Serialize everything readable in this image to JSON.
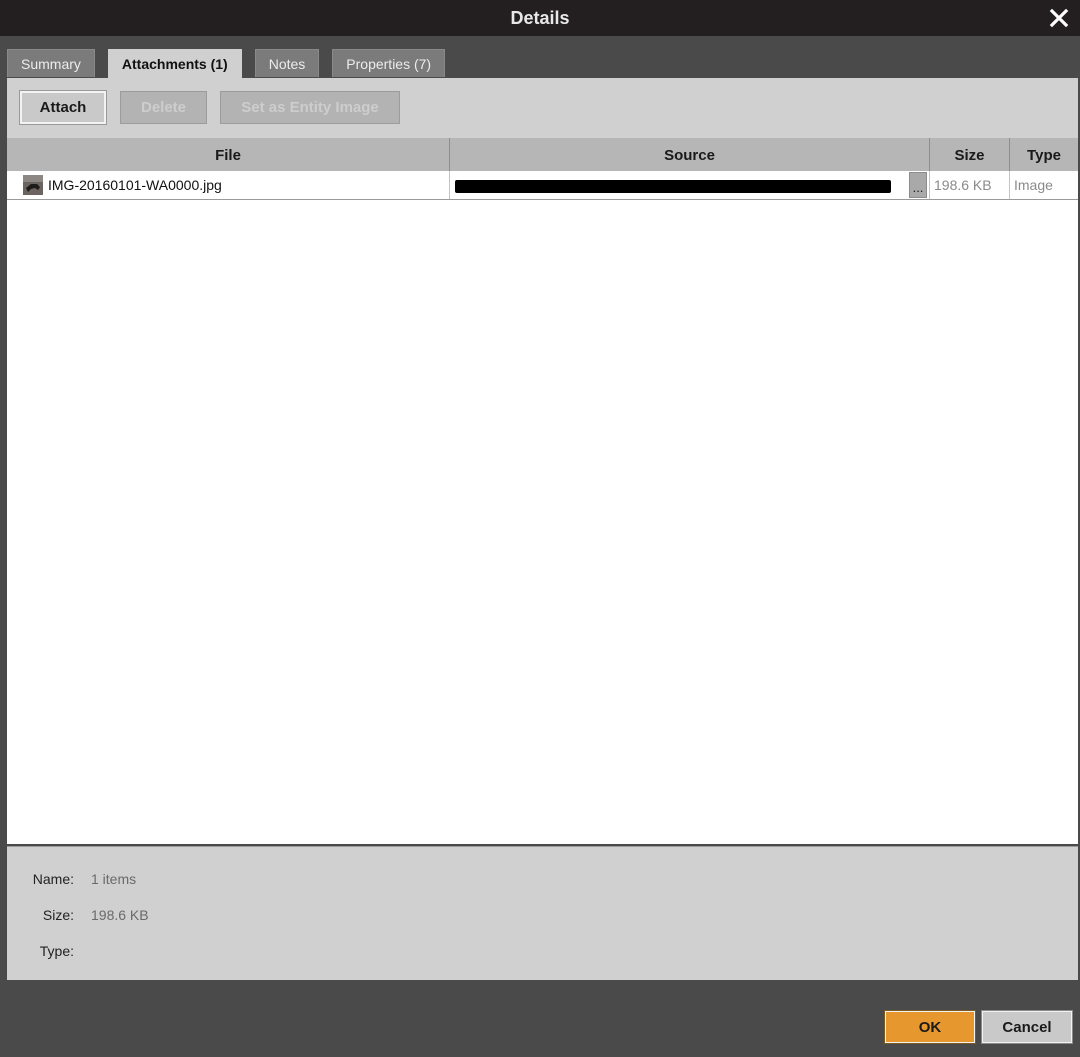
{
  "window": {
    "title": "Details"
  },
  "tabs": [
    {
      "label": "Summary"
    },
    {
      "label": "Attachments (1)"
    },
    {
      "label": "Notes"
    },
    {
      "label": "Properties (7)"
    }
  ],
  "active_tab": "Attachments (1)",
  "toolbar": {
    "attach_label": "Attach",
    "delete_label": "Delete",
    "set_entity_image_label": "Set as Entity Image"
  },
  "table": {
    "columns": [
      "File",
      "Source",
      "Size",
      "Type"
    ],
    "rows": [
      {
        "file": "IMG-20160101-WA0000.jpg",
        "source": "",
        "size": "198.6 KB",
        "type": "Image"
      }
    ],
    "browse_label": "..."
  },
  "info": {
    "name_label": "Name:",
    "name_value": "1 items",
    "size_label": "Size:",
    "size_value": "198.6 KB",
    "type_label": "Type:",
    "type_value": ""
  },
  "footer": {
    "ok_label": "OK",
    "cancel_label": "Cancel"
  },
  "colors": {
    "titlebar": "#231f20",
    "background": "#4b4a4a",
    "panel": "#d0d0d0",
    "accent_ok": "#e6982f"
  }
}
